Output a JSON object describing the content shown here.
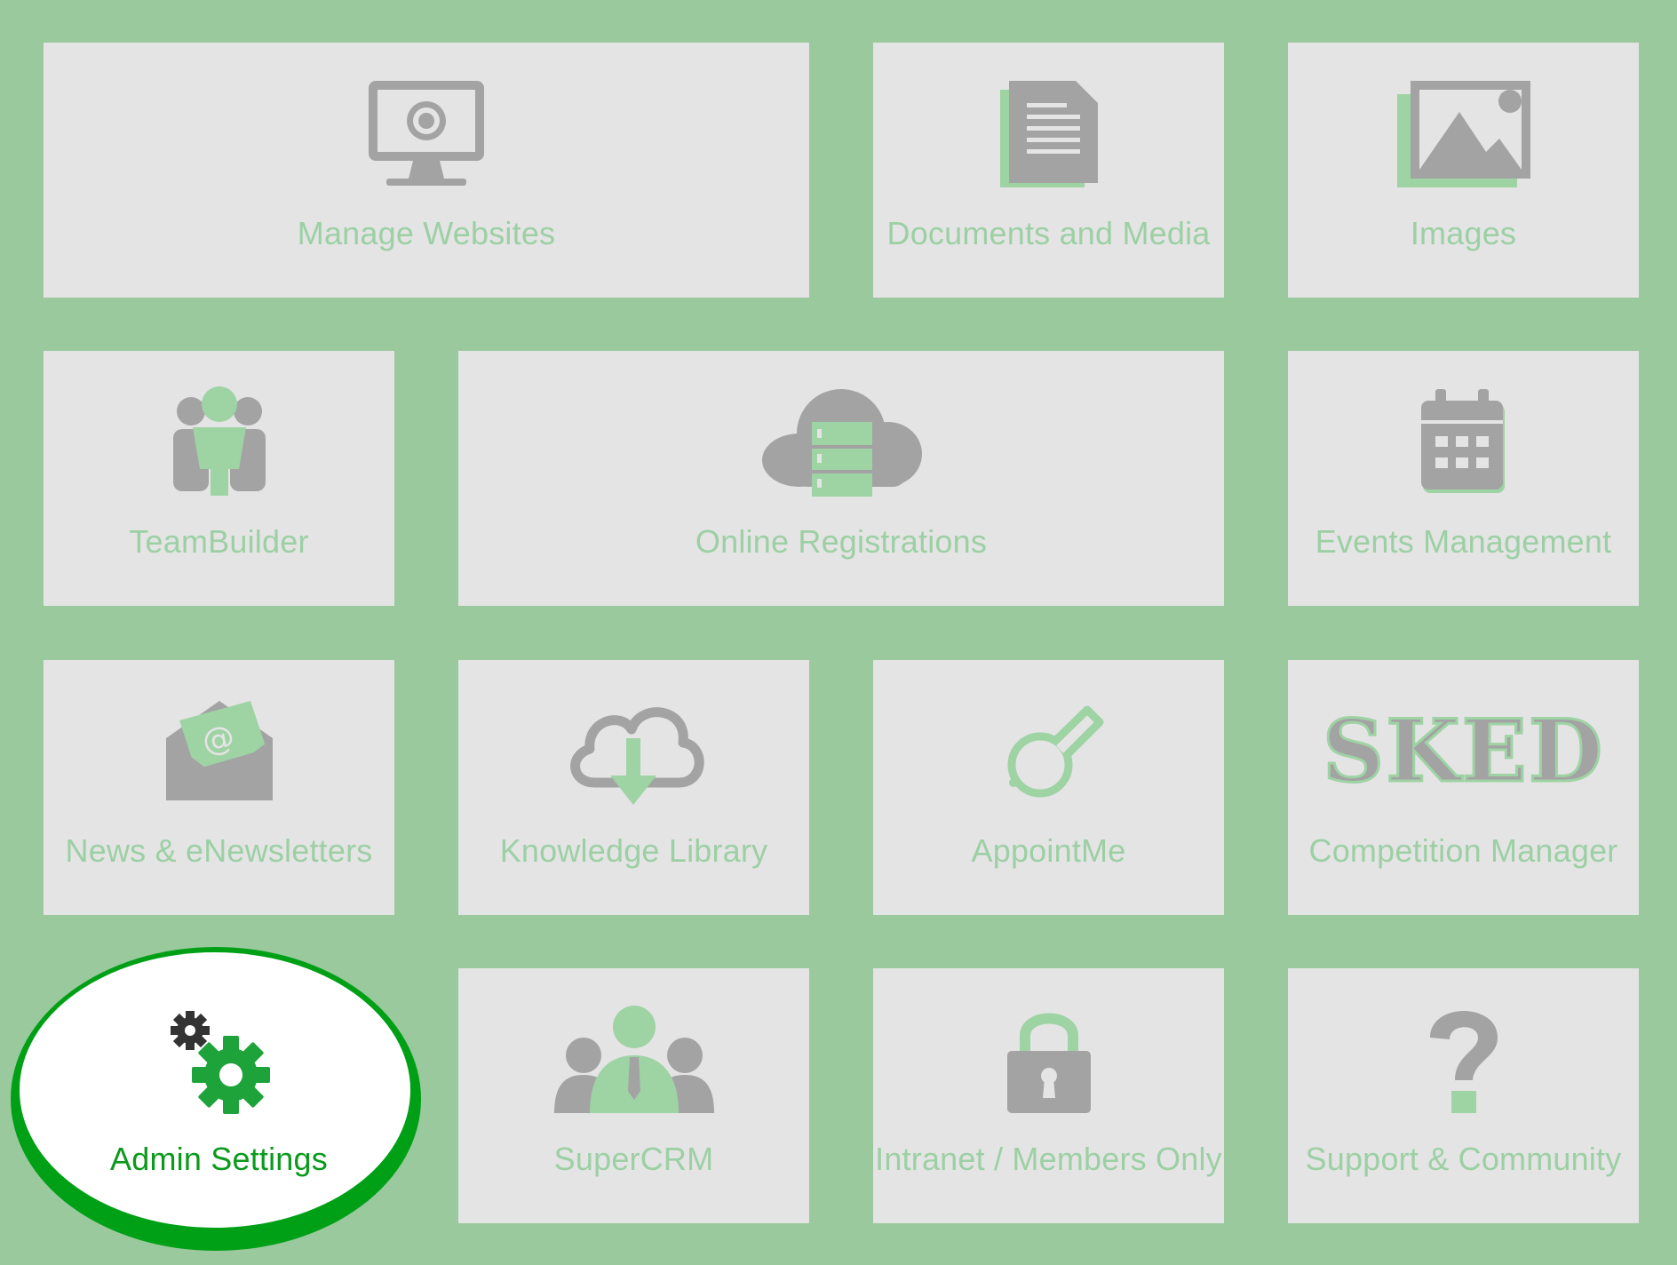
{
  "colors": {
    "background": "#9ac99e",
    "tile": "#e4e4e4",
    "label": "#9cd0a4",
    "icon_gray": "#a3a3a3",
    "icon_green": "#9ed3a4",
    "active_label": "#0b9a1c",
    "active_icon": "#1ea33a",
    "highlight_ring": "#00a016"
  },
  "tiles": [
    {
      "label": "Manage Websites",
      "icon": "monitor-icon"
    },
    {
      "label": "Documents and Media",
      "icon": "document-icon"
    },
    {
      "label": "Images",
      "icon": "image-icon"
    },
    {
      "label": "TeamBuilder",
      "icon": "team-icon"
    },
    {
      "label": "Online Registrations",
      "icon": "cloud-server-icon"
    },
    {
      "label": "Events Management",
      "icon": "calendar-icon"
    },
    {
      "label": "News & eNewsletters",
      "icon": "envelope-icon"
    },
    {
      "label": "Knowledge Library",
      "icon": "cloud-download-icon"
    },
    {
      "label": "AppointMe",
      "icon": "whistle-icon"
    },
    {
      "label": "Competition Manager",
      "icon": "sked-logo",
      "logo_text": "SKED"
    },
    {
      "label": "Admin Settings",
      "icon": "gears-icon",
      "highlighted": true
    },
    {
      "label": "SuperCRM",
      "icon": "crm-people-icon"
    },
    {
      "label": "Intranet / Members Only",
      "icon": "lock-icon"
    },
    {
      "label": "Support & Community",
      "icon": "question-icon"
    }
  ]
}
